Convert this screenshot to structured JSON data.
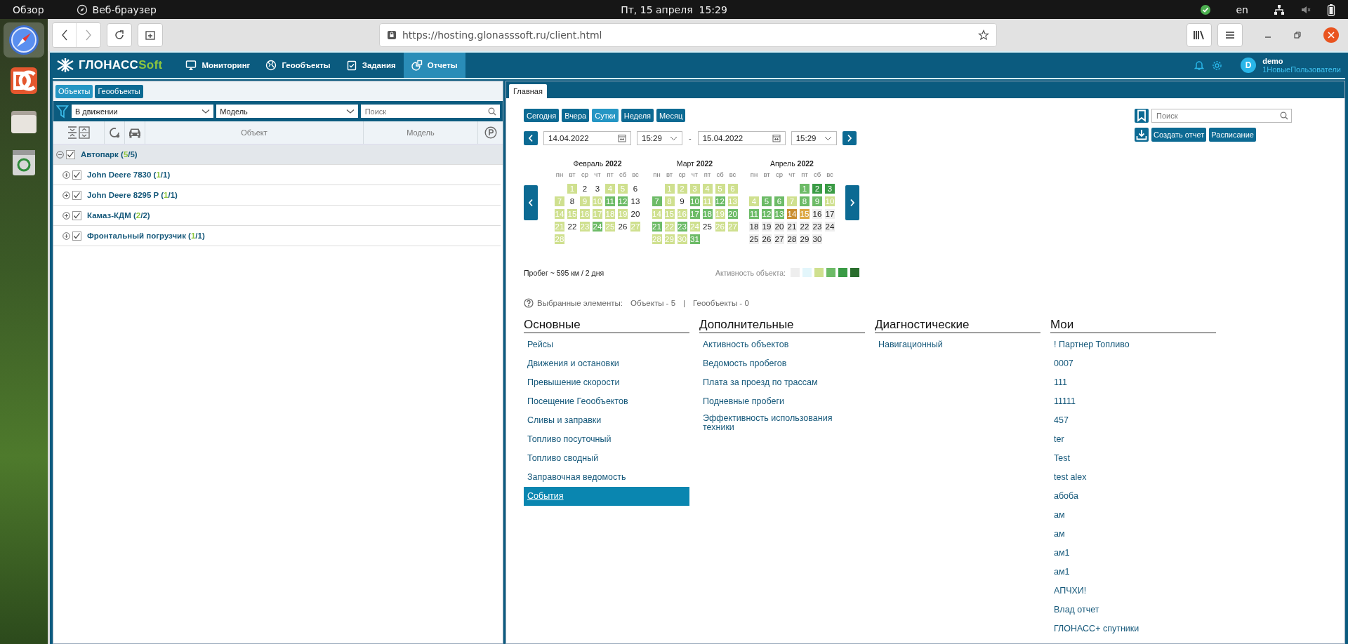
{
  "os_bar": {
    "activities": "Обзор",
    "app_name": "Веб-браузер",
    "clock": "Пт, 15 апреля  15:29",
    "language": "en"
  },
  "browser": {
    "url": "https://hosting.glonasssoft.ru/client.html"
  },
  "app": {
    "logo_main": "ГЛОНАСС",
    "logo_accent": "Soft",
    "nav": [
      {
        "label": "Мониторинг",
        "selected": false
      },
      {
        "label": "Геообъекты",
        "selected": false
      },
      {
        "label": "Задания",
        "selected": false
      },
      {
        "label": "Отчеты",
        "selected": true
      }
    ],
    "user": {
      "initial": "D",
      "name": "demo",
      "group": "1НовыеПользователи"
    }
  },
  "left_panel": {
    "tabs": [
      {
        "label": "Объекты",
        "selected": true
      },
      {
        "label": "Геообъекты",
        "selected": false
      }
    ],
    "filters": {
      "state": "В движении",
      "model": "Модель",
      "search_placeholder": "Поиск"
    },
    "columns": [
      "Объект",
      "Модель"
    ],
    "tree": [
      {
        "name": "Автопарк",
        "count": [
          "(",
          "5",
          "/5)"
        ],
        "expanded": true,
        "checked": true,
        "children": [
          {
            "name": "John Deere 7830",
            "count": [
              "(",
              "1",
              "/1)"
            ],
            "expanded": false,
            "checked": true
          },
          {
            "name": "John Deere 8295 P",
            "count": [
              "(",
              "1",
              "/1)"
            ],
            "expanded": false,
            "checked": true
          },
          {
            "name": "Камаз-КДМ",
            "count": [
              "(",
              "2",
              "/2)"
            ],
            "expanded": false,
            "checked": true
          },
          {
            "name": "Фронтальный погрузчик",
            "count": [
              "(",
              "1",
              "/1)"
            ],
            "expanded": false,
            "checked": true
          }
        ]
      }
    ]
  },
  "reports": {
    "tabs": [
      {
        "label": "Главная",
        "selected": true
      }
    ],
    "periods": [
      {
        "label": "Сегодня",
        "selected": false
      },
      {
        "label": "Вчера",
        "selected": false
      },
      {
        "label": "Сутки",
        "selected": true
      },
      {
        "label": "Неделя",
        "selected": false
      },
      {
        "label": "Месяц",
        "selected": false
      }
    ],
    "date_from": "14.04.2022",
    "time_from": "15:29",
    "separator": "-",
    "date_to": "15.04.2022",
    "time_to": "15:29",
    "search_placeholder": "Поиск",
    "actions": [
      "Создать отчет",
      "Расписание"
    ],
    "calendar": [
      {
        "title": "Февраль **2022**",
        "weekdays": [
          "пн",
          "вт",
          "ср",
          "чт",
          "пт",
          "сб",
          "вс"
        ],
        "weeks": [
          [
            {
              "kind": "blank"
            },
            {
              "kind": "day",
              "day": "1",
              "color": "#cfe08f"
            },
            {
              "kind": "day",
              "day": "2"
            },
            {
              "kind": "day",
              "day": "3"
            },
            {
              "kind": "day",
              "day": "4",
              "color": "#cfe08f"
            },
            {
              "kind": "day",
              "day": "5",
              "color": "#cfe08f"
            },
            {
              "kind": "day",
              "day": "6"
            }
          ],
          [
            {
              "kind": "day",
              "day": "7",
              "color": "#cfe08f"
            },
            {
              "kind": "day",
              "day": "8"
            },
            {
              "kind": "day",
              "day": "9",
              "color": "#cfe08f"
            },
            {
              "kind": "day",
              "day": "10",
              "color": "#cfe08f"
            },
            {
              "kind": "day",
              "day": "11",
              "color": "#6dbb67"
            },
            {
              "kind": "day",
              "day": "12",
              "color": "#6dbb67"
            },
            {
              "kind": "day",
              "day": "13"
            }
          ],
          [
            {
              "kind": "day",
              "day": "14",
              "color": "#cfe08f"
            },
            {
              "kind": "day",
              "day": "15",
              "color": "#cfe08f"
            },
            {
              "kind": "day",
              "day": "16",
              "color": "#cfe08f"
            },
            {
              "kind": "day",
              "day": "17",
              "color": "#cfe08f"
            },
            {
              "kind": "day",
              "day": "18",
              "color": "#cfe08f"
            },
            {
              "kind": "day",
              "day": "19",
              "color": "#cfe08f"
            },
            {
              "kind": "day",
              "day": "20"
            }
          ],
          [
            {
              "kind": "day",
              "day": "21",
              "color": "#cfe08f"
            },
            {
              "kind": "day",
              "day": "22"
            },
            {
              "kind": "day",
              "day": "23",
              "color": "#cfe08f"
            },
            {
              "kind": "day",
              "day": "24",
              "color": "#6dbb67"
            },
            {
              "kind": "day",
              "day": "25",
              "color": "#cfe08f"
            },
            {
              "kind": "day",
              "day": "26"
            },
            {
              "kind": "day",
              "day": "27",
              "color": "#cfe08f"
            }
          ],
          [
            {
              "kind": "day",
              "day": "28",
              "color": "#cfe08f"
            }
          ]
        ]
      },
      {
        "title": "Март **2022**",
        "weekdays": [
          "пн",
          "вт",
          "ср",
          "чт",
          "пт",
          "сб",
          "вс"
        ],
        "weeks": [
          [
            {
              "kind": "blank"
            },
            {
              "kind": "day",
              "day": "1",
              "color": "#cfe08f"
            },
            {
              "kind": "day",
              "day": "2",
              "color": "#cfe08f"
            },
            {
              "kind": "day",
              "day": "3",
              "color": "#cfe08f"
            },
            {
              "kind": "day",
              "day": "4",
              "color": "#cfe08f"
            },
            {
              "kind": "day",
              "day": "5",
              "color": "#cfe08f"
            },
            {
              "kind": "day",
              "day": "6",
              "color": "#cfe08f"
            }
          ],
          [
            {
              "kind": "day",
              "day": "7",
              "color": "#6dbb67"
            },
            {
              "kind": "day",
              "day": "8",
              "color": "#cfe08f"
            },
            {
              "kind": "day",
              "day": "9"
            },
            {
              "kind": "day",
              "day": "10",
              "color": "#6dbb67"
            },
            {
              "kind": "day",
              "day": "11",
              "color": "#cfe08f"
            },
            {
              "kind": "day",
              "day": "12",
              "color": "#6dbb67"
            },
            {
              "kind": "day",
              "day": "13",
              "color": "#cfe08f"
            }
          ],
          [
            {
              "kind": "day",
              "day": "14",
              "color": "#cfe08f"
            },
            {
              "kind": "day",
              "day": "15",
              "color": "#cfe08f"
            },
            {
              "kind": "day",
              "day": "16",
              "color": "#cfe08f"
            },
            {
              "kind": "day",
              "day": "17",
              "color": "#6dbb67"
            },
            {
              "kind": "day",
              "day": "18",
              "color": "#6dbb67"
            },
            {
              "kind": "day",
              "day": "19",
              "color": "#cfe08f"
            },
            {
              "kind": "day",
              "day": "20",
              "color": "#6dbb67"
            }
          ],
          [
            {
              "kind": "day",
              "day": "21",
              "color": "#6dbb67"
            },
            {
              "kind": "day",
              "day": "22",
              "color": "#cfe08f"
            },
            {
              "kind": "day",
              "day": "23",
              "color": "#6dbb67"
            },
            {
              "kind": "day",
              "day": "24",
              "color": "#cfe08f"
            },
            {
              "kind": "day",
              "day": "25"
            },
            {
              "kind": "day",
              "day": "26",
              "color": "#cfe08f"
            },
            {
              "kind": "day",
              "day": "27",
              "color": "#cfe08f"
            }
          ],
          [
            {
              "kind": "day",
              "day": "28",
              "color": "#cfe08f"
            },
            {
              "kind": "day",
              "day": "29",
              "color": "#cfe08f"
            },
            {
              "kind": "day",
              "day": "30",
              "color": "#cfe08f"
            },
            {
              "kind": "day",
              "day": "31",
              "color": "#6dbb67"
            }
          ]
        ]
      },
      {
        "title": "Апрель **2022**",
        "weekdays": [
          "пн",
          "вт",
          "ср",
          "чт",
          "пт",
          "сб",
          "вс"
        ],
        "weeks": [
          [
            {
              "kind": "blank"
            },
            {
              "kind": "blank"
            },
            {
              "kind": "blank"
            },
            {
              "kind": "blank"
            },
            {
              "kind": "day",
              "day": "1",
              "color": "#6dbb67"
            },
            {
              "kind": "day",
              "day": "2",
              "color": "#3a9b45"
            },
            {
              "kind": "day",
              "day": "3",
              "color": "#3a9b45"
            }
          ],
          [
            {
              "kind": "day",
              "day": "4",
              "color": "#cfe08f"
            },
            {
              "kind": "day",
              "day": "5",
              "color": "#6dbb67"
            },
            {
              "kind": "day",
              "day": "6",
              "color": "#6dbb67"
            },
            {
              "kind": "day",
              "day": "7",
              "color": "#cfe08f"
            },
            {
              "kind": "day",
              "day": "8",
              "color": "#6dbb67"
            },
            {
              "kind": "day",
              "day": "9",
              "color": "#6dbb67"
            },
            {
              "kind": "day",
              "day": "10",
              "color": "#cfe08f"
            }
          ],
          [
            {
              "kind": "day",
              "day": "11",
              "color": "#6dbb67"
            },
            {
              "kind": "day",
              "day": "12",
              "color": "#6dbb67"
            },
            {
              "kind": "day",
              "day": "13",
              "color": "#6dbb67"
            },
            {
              "kind": "day",
              "day": "14",
              "color": "#c98d2f"
            },
            {
              "kind": "day",
              "day": "15",
              "color": "#dca743"
            },
            {
              "kind": "day",
              "day": "16",
              "color": "#eeeeee"
            },
            {
              "kind": "day",
              "day": "17",
              "color": "#eeeeee"
            }
          ],
          [
            {
              "kind": "day",
              "day": "18",
              "color": "#eeeeee"
            },
            {
              "kind": "day",
              "day": "19",
              "color": "#eeeeee"
            },
            {
              "kind": "day",
              "day": "20",
              "color": "#eeeeee"
            },
            {
              "kind": "day",
              "day": "21",
              "color": "#eeeeee"
            },
            {
              "kind": "day",
              "day": "22",
              "color": "#eeeeee"
            },
            {
              "kind": "day",
              "day": "23",
              "color": "#eeeeee"
            },
            {
              "kind": "day",
              "day": "24",
              "color": "#eeeeee"
            }
          ],
          [
            {
              "kind": "day",
              "day": "25",
              "color": "#eeeeee"
            },
            {
              "kind": "day",
              "day": "26",
              "color": "#eeeeee"
            },
            {
              "kind": "day",
              "day": "27",
              "color": "#eeeeee"
            },
            {
              "kind": "day",
              "day": "28",
              "color": "#eeeeee"
            },
            {
              "kind": "day",
              "day": "29",
              "color": "#eeeeee"
            },
            {
              "kind": "day",
              "day": "30",
              "color": "#eeeeee"
            }
          ]
        ]
      }
    ],
    "mileage": "Пробег ~ 595 км / 2 дня",
    "legend_label": "Активность объекта:",
    "legend": [
      {
        "color": "#eeeeee"
      },
      {
        "color": "#e3f6fb"
      },
      {
        "color": "#cfe08f"
      },
      {
        "color": "#6dbb67"
      },
      {
        "color": "#3a9b45"
      },
      {
        "color": "#2a6e2e"
      }
    ],
    "selection": {
      "label": "Выбранные элементы:",
      "objects": "Объекты - 5",
      "divider": "|",
      "geo": "Геообъекты - 0"
    },
    "groups": [
      {
        "title": "Основные",
        "items": [
          {
            "label": "Рейсы",
            "selected": false
          },
          {
            "label": "Движения и остановки",
            "selected": false
          },
          {
            "label": "Превышение скорости",
            "selected": false
          },
          {
            "label": "Посещение Геообъектов",
            "selected": false
          },
          {
            "label": "Сливы и заправки",
            "selected": false
          },
          {
            "label": "Топливо посуточный",
            "selected": false
          },
          {
            "label": "Топливо сводный",
            "selected": false
          },
          {
            "label": "Заправочная ведомость",
            "selected": false
          },
          {
            "label": "События",
            "selected": true
          }
        ]
      },
      {
        "title": "Дополнительные",
        "items": [
          {
            "label": "Активность объектов",
            "selected": false
          },
          {
            "label": "Ведомость пробегов",
            "selected": false
          },
          {
            "label": "Плата за проезд по трассам",
            "selected": false
          },
          {
            "label": "Подневные пробеги",
            "selected": false
          },
          {
            "label": "Эффективность использования техники",
            "selected": false
          }
        ]
      },
      {
        "title": "Диагностические",
        "items": [
          {
            "label": "Навигационный",
            "selected": false
          }
        ]
      },
      {
        "title": "Мои",
        "items": [
          {
            "label": "! Партнер Топливо",
            "selected": false
          },
          {
            "label": "0007",
            "selected": false
          },
          {
            "label": "111",
            "selected": false
          },
          {
            "label": "11111",
            "selected": false
          },
          {
            "label": "457",
            "selected": false
          },
          {
            "label": "ter",
            "selected": false
          },
          {
            "label": "Test",
            "selected": false
          },
          {
            "label": "test alex",
            "selected": false
          },
          {
            "label": "абоба",
            "selected": false
          },
          {
            "label": "ам",
            "selected": false
          },
          {
            "label": "ам",
            "selected": false
          },
          {
            "label": "ам1",
            "selected": false
          },
          {
            "label": "ам1",
            "selected": false
          },
          {
            "label": "АПЧХИ!",
            "selected": false
          },
          {
            "label": "Влад отчет",
            "selected": false
          },
          {
            "label": "ГЛОНАСС+ спутники",
            "selected": false
          }
        ]
      }
    ]
  }
}
